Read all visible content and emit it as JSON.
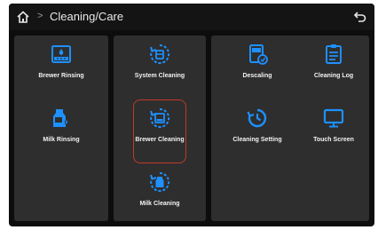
{
  "header": {
    "separator": ">",
    "title": "Cleaning/Care"
  },
  "icons": {
    "accent": "#1e90ff",
    "highlight_border": "#c0392b"
  },
  "tiles": [
    {
      "label": "Brewer Rinsing",
      "icon": "brewer-rinsing-icon"
    },
    {
      "label": "Milk Rinsing",
      "icon": "milk-rinsing-icon"
    },
    {
      "label": "System Cleaning",
      "icon": "system-cleaning-icon"
    },
    {
      "label": "Brewer Cleaning",
      "icon": "brewer-cleaning-icon",
      "highlighted": true
    },
    {
      "label": "Milk Cleaning",
      "icon": "milk-cleaning-icon"
    },
    {
      "label": "Descaling",
      "icon": "descaling-icon"
    },
    {
      "label": "Cleaning Log",
      "icon": "cleaning-log-icon"
    },
    {
      "label": "Cleaning Setting",
      "icon": "cleaning-setting-icon"
    },
    {
      "label": "Touch Screen",
      "icon": "touch-screen-icon"
    }
  ]
}
